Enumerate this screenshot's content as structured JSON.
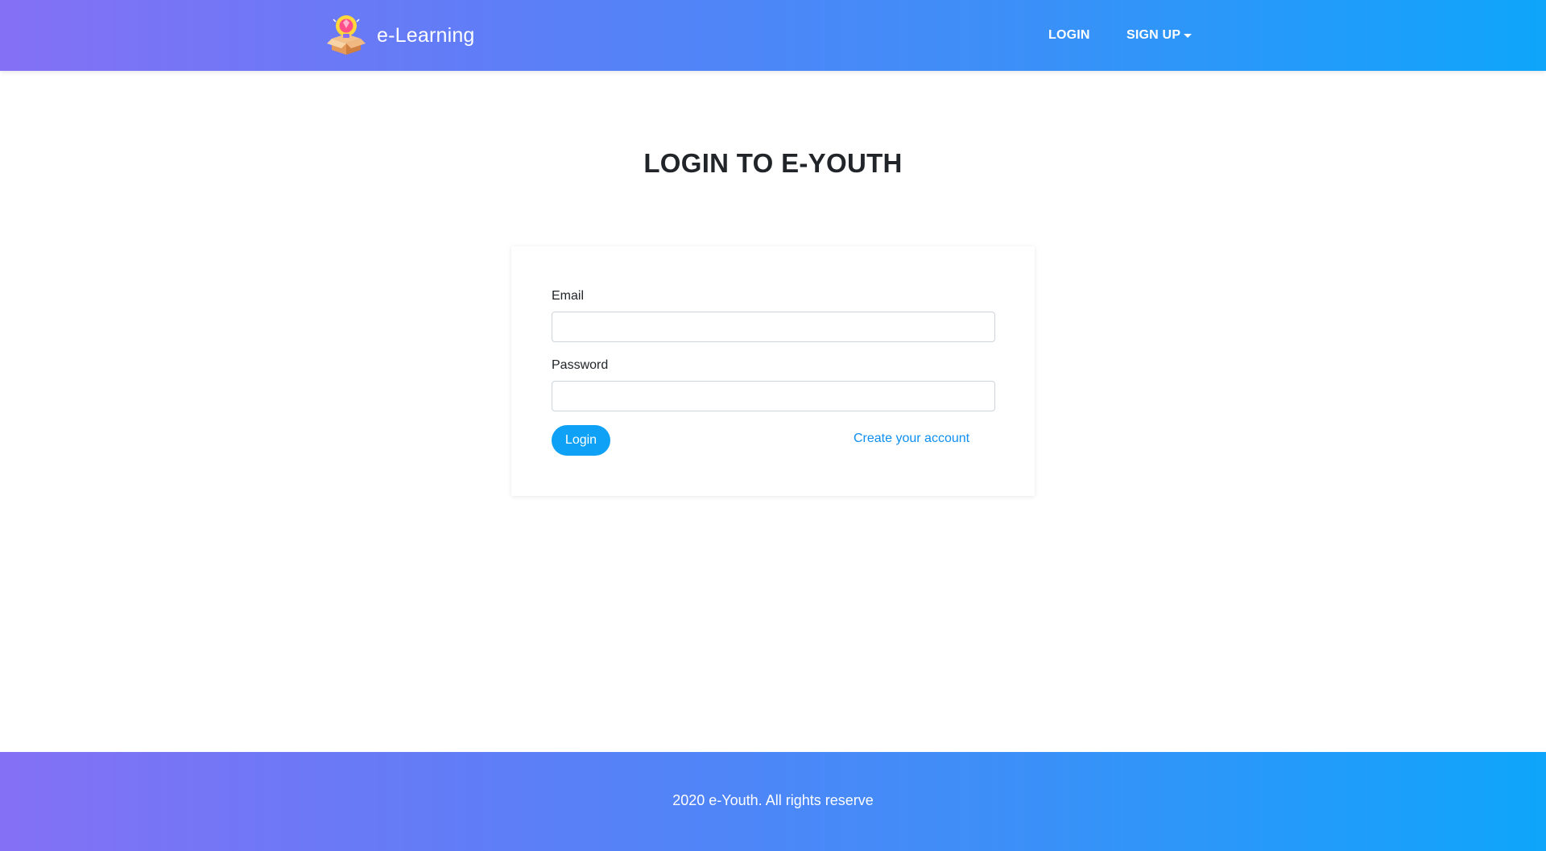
{
  "header": {
    "brand_name": "e-Learning",
    "brand_logo_icon": "lightbulb-box-icon",
    "nav": {
      "login_label": "LOGIN",
      "signup_label": "SIGN UP"
    },
    "gradient_start": "#8470f5",
    "gradient_end": "#0ea5fb"
  },
  "main": {
    "title": "LOGIN TO E-YOUTH",
    "form": {
      "email_label": "Email",
      "email_value": "",
      "password_label": "Password",
      "password_value": "",
      "login_button_label": "Login",
      "create_account_label": "Create your account"
    },
    "accent_color": "#0ea1f5"
  },
  "footer": {
    "text": "2020 e-Youth. All rights reserve"
  }
}
